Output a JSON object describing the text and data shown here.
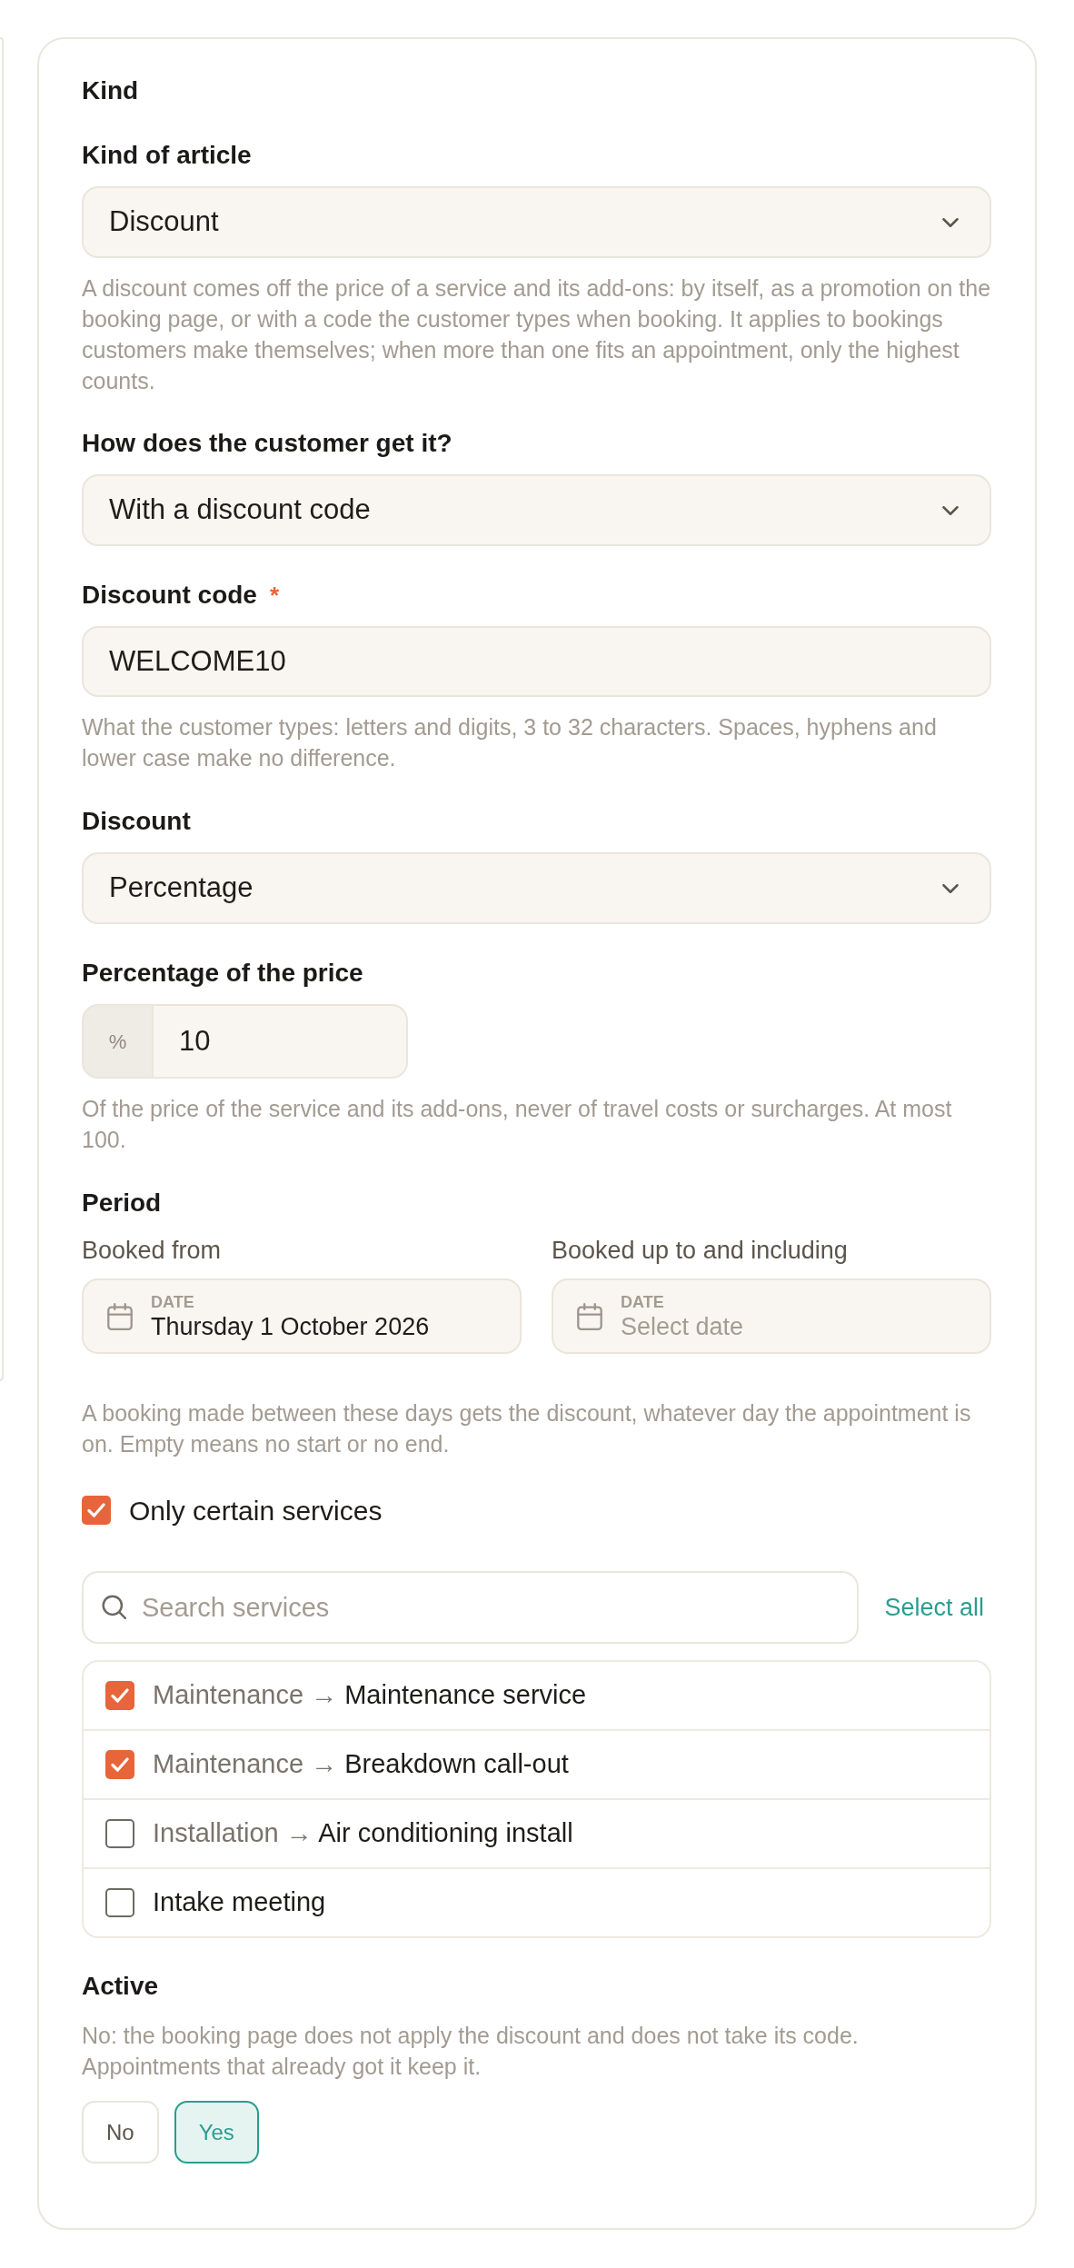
{
  "section": {
    "title": "Kind"
  },
  "article_kind": {
    "label": "Kind of article",
    "value": "Discount",
    "help": "A discount comes off the price of a service and its add-ons: by itself, as a promotion on the booking page, or with a code the customer types when booking. It applies to bookings customers make themselves; when more than one fits an appointment, only the highest counts."
  },
  "delivery": {
    "label": "How does the customer get it?",
    "value": "With a discount code"
  },
  "discount_code": {
    "label": "Discount code",
    "required_mark": "*",
    "value": "WELCOME10",
    "help": "What the customer types: letters and digits, 3 to 32 characters. Spaces, hyphens and lower case make no difference."
  },
  "discount_type": {
    "label": "Discount",
    "value": "Percentage"
  },
  "percentage": {
    "label": "Percentage of the price",
    "unit": "%",
    "value": "10",
    "help": "Of the price of the service and its add-ons, never of travel costs or surcharges. At most 100."
  },
  "period": {
    "title": "Period",
    "dates": [
      {
        "label": "Booked from",
        "caption": "DATE",
        "value": "Thursday 1 October 2026"
      },
      {
        "label": "Booked up to and including",
        "caption": "DATE",
        "placeholder": "Select date"
      }
    ],
    "help": "A booking made between these days gets the discount, whatever day the appointment is on. Empty means no start or no end."
  },
  "only_certain_services": {
    "label": "Only certain services",
    "checked": true
  },
  "service_search": {
    "placeholder": "Search services",
    "select_all": "Select all"
  },
  "services": [
    {
      "category": "Maintenance",
      "arrow": "→",
      "name": "Maintenance service",
      "checked": true
    },
    {
      "category": "Maintenance",
      "arrow": "→",
      "name": "Breakdown call-out",
      "checked": true
    },
    {
      "category": "Installation",
      "arrow": "→",
      "name": "Air conditioning install",
      "checked": false
    },
    {
      "name": "Intake meeting",
      "checked": false
    }
  ],
  "active": {
    "label": "Active",
    "help": "No: the booking page does not apply the discount and does not take its code. Appointments that already got it keep it.",
    "options": [
      {
        "label": "No",
        "selected": false
      },
      {
        "label": "Yes",
        "selected": true
      }
    ]
  }
}
